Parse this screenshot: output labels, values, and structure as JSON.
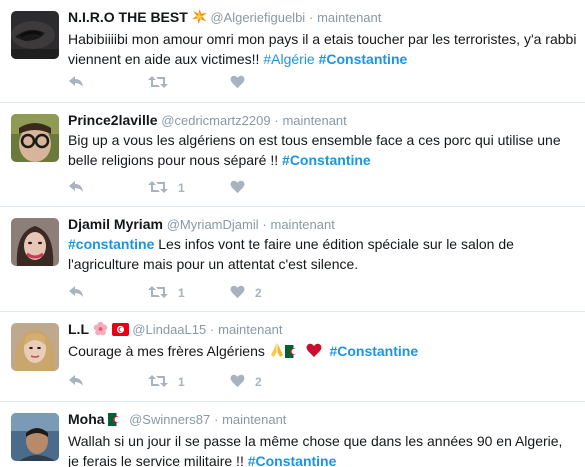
{
  "colors": {
    "hashtag": "#1b95e0",
    "muted": "#8899a6",
    "action": "#a8b3bd",
    "divider": "#e1e8ed",
    "heart_red": "#c8102e"
  },
  "tweets": [
    {
      "name": "N.I.R.O THE BEST",
      "name_emoji": "collision",
      "handle": "@Algeriefiguelbi",
      "sep": "·",
      "time": "maintenant",
      "text_plain": "Habibiiiibi mon amour omri mon pays il a etais toucher par les terroristes, y'a rabbi viennent en aide aux victimes!! ",
      "hashtag1": "#Algérie",
      "hashtag2": "#Constantine",
      "retweets": "",
      "likes": ""
    },
    {
      "name": "Prince2laville",
      "handle": "@cedricmartz2209",
      "sep": "·",
      "time": "maintenant",
      "text_plain": "Big up a vous les algériens on est tous ensemble face a ces porc qui utilise une belle religions pour nous séparé !! ",
      "hashtag": "#Constantine",
      "retweets": "1",
      "likes": ""
    },
    {
      "name": "Djamil Myriam",
      "handle": "@MyriamDjamil",
      "sep": "·",
      "time": "maintenant",
      "hashtag": "#constantine",
      "text_plain": " Les infos vont te faire une édition spéciale sur le salon de l'agriculture mais pour un attentat c'est silence.",
      "retweets": "1",
      "likes": "2"
    },
    {
      "name": "L.L",
      "name_emojis": [
        "cherry-blossom",
        "flag-tunisia"
      ],
      "handle": "@LindaaL15",
      "sep": "·",
      "time": "maintenant",
      "text_plain": "Courage à mes frères Algériens ",
      "text_emojis": [
        "folded-hands",
        "flag-algeria",
        "red-heart"
      ],
      "hashtag": "#Constantine",
      "retweets": "1",
      "likes": "2"
    },
    {
      "name": "Moha",
      "name_emoji": "flag-algeria",
      "handle": "@Swinners87",
      "sep": "·",
      "time": "maintenant",
      "text_plain": "Wallah si un jour il se passe la même chose que dans les années 90 en Algerie, je ferais le service militaire !! ",
      "hashtag": "#Constantine"
    }
  ]
}
